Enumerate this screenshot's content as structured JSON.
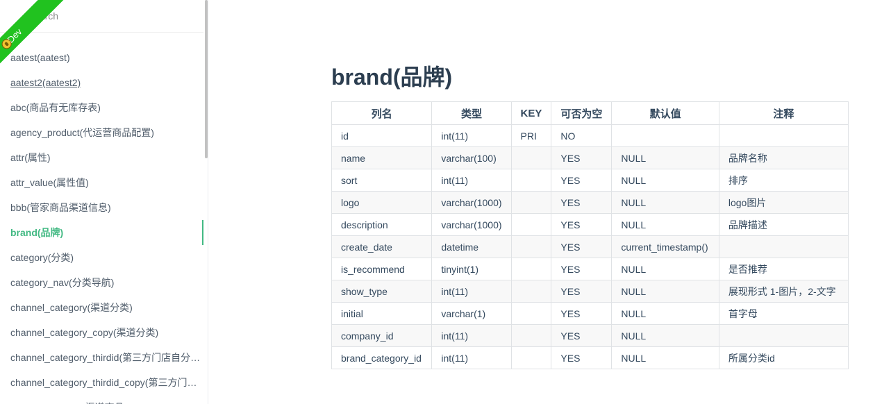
{
  "sidebar": {
    "ribbon_label": "Dev",
    "search_placeholder": "search",
    "items": [
      {
        "label": "aatest(aatest)"
      },
      {
        "label": "aatest2(aatest2)"
      },
      {
        "label": "abc(商品有无库存表)"
      },
      {
        "label": "agency_product(代运营商品配置)"
      },
      {
        "label": "attr(属性)"
      },
      {
        "label": "attr_value(属性值)"
      },
      {
        "label": "bbb(管家商品渠道信息)"
      },
      {
        "label": "brand(品牌)"
      },
      {
        "label": "category(分类)"
      },
      {
        "label": "category_nav(分类导航)"
      },
      {
        "label": "channel_category(渠道分类)"
      },
      {
        "label": "channel_category_copy(渠道分类)"
      },
      {
        "label": "channel_category_thirdid(第三方门店自分…"
      },
      {
        "label": "channel_category_thirdid_copy(第三方门店…"
      },
      {
        "label": "(渠道商品)"
      }
    ]
  },
  "main": {
    "title": "brand(品牌)",
    "table": {
      "headers": [
        "列名",
        "类型",
        "KEY",
        "可否为空",
        "默认值",
        "注释"
      ],
      "rows": [
        [
          "id",
          "int(11)",
          "PRI",
          "NO",
          "",
          ""
        ],
        [
          "name",
          "varchar(100)",
          "",
          "YES",
          "NULL",
          "品牌名称"
        ],
        [
          "sort",
          "int(11)",
          "",
          "YES",
          "NULL",
          "排序"
        ],
        [
          "logo",
          "varchar(1000)",
          "",
          "YES",
          "NULL",
          "logo图片"
        ],
        [
          "description",
          "varchar(1000)",
          "",
          "YES",
          "NULL",
          "品牌描述"
        ],
        [
          "create_date",
          "datetime",
          "",
          "YES",
          "current_timestamp()",
          ""
        ],
        [
          "is_recommend",
          "tinyint(1)",
          "",
          "YES",
          "NULL",
          "是否推荐"
        ],
        [
          "show_type",
          "int(11)",
          "",
          "YES",
          "NULL",
          "展现形式 1-图片，2-文字"
        ],
        [
          "initial",
          "varchar(1)",
          "",
          "YES",
          "NULL",
          "首字母"
        ],
        [
          "company_id",
          "int(11)",
          "",
          "YES",
          "NULL",
          ""
        ],
        [
          "brand_category_id",
          "int(11)",
          "",
          "YES",
          "NULL",
          "所属分类id"
        ]
      ]
    }
  },
  "colors": {
    "accent": "#42b983",
    "ribbon": "#21c21f",
    "text": "#34495e"
  }
}
